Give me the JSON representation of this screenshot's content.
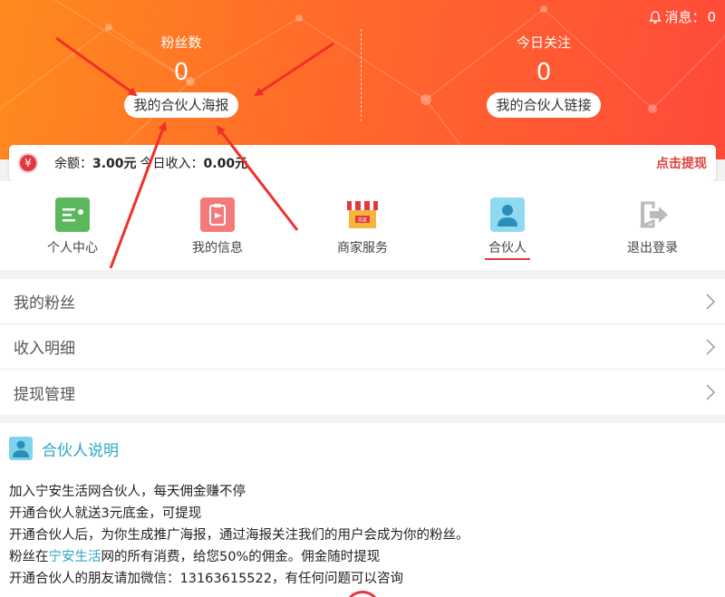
{
  "header": {
    "messages_label": "消息：",
    "messages_count": "0",
    "fans_label": "粉丝数",
    "fans_count": "0",
    "poster_button": "我的合伙人海报",
    "today_label": "今日关注",
    "today_count": "0",
    "link_button": "我的合伙人链接"
  },
  "balance": {
    "coin_glyph": "¥",
    "balance_label": "余额：",
    "balance_value": "3.00元",
    "income_label": "今日收入：",
    "income_value": "0.00元",
    "withdraw_label": "点击提现"
  },
  "nav": {
    "items": [
      {
        "label": "个人中心",
        "icon": "id-card-icon"
      },
      {
        "label": "我的信息",
        "icon": "clipboard-icon"
      },
      {
        "label": "商家服务",
        "icon": "shop-icon",
        "badge": "商家"
      },
      {
        "label": "合伙人",
        "icon": "partner-icon",
        "active": true
      },
      {
        "label": "退出登录",
        "icon": "logout-icon"
      }
    ]
  },
  "menu": {
    "items": [
      "我的粉丝",
      "收入明细",
      "提现管理"
    ]
  },
  "explain": {
    "title": "合伙人说明",
    "line1": "加入宁安生活网合伙人，每天佣金赚不停",
    "line2": "开通合伙人就送3元底金，可提现",
    "line3": "开通合伙人后，为你生成推广海报，通过海报关注我们的用户会成为你的粉丝。",
    "line4_pre": "粉丝在",
    "line4_hl": "宁安生活",
    "line4_post": "网的所有消费，给您50%的佣金。佣金随时提现",
    "line5": "开通合伙人的朋友请加微信：13163615522，有任何问题可以咨询"
  },
  "colors": {
    "accent_red": "#e3383e",
    "header_orange": "#ff7a22",
    "title_blue": "#2aa6c7"
  }
}
